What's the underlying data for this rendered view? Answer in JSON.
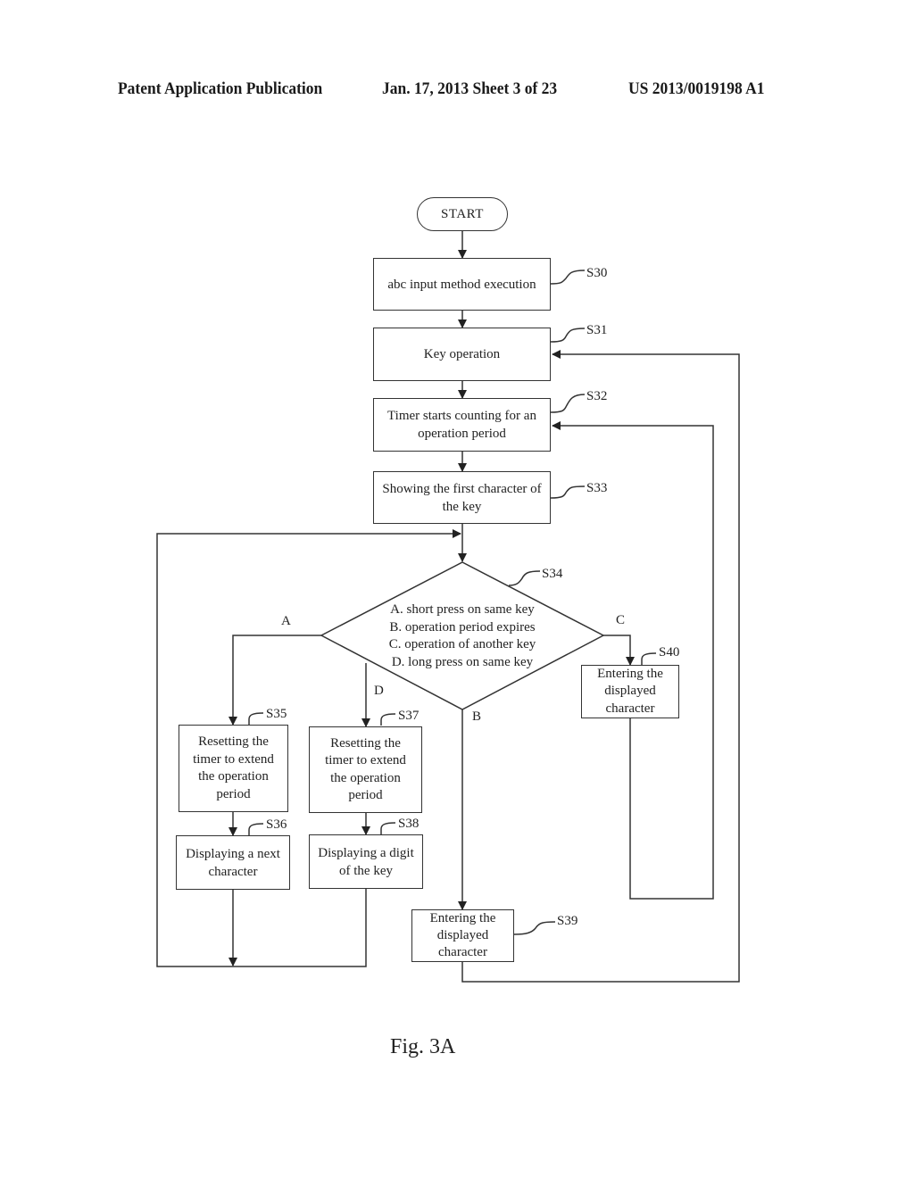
{
  "header": {
    "publication": "Patent Application Publication",
    "date_sheet": "Jan. 17, 2013  Sheet 3 of 23",
    "number": "US 2013/0019198 A1"
  },
  "flowchart": {
    "start": "START",
    "steps": {
      "s30": {
        "id": "S30",
        "text": "abc input method execution"
      },
      "s31": {
        "id": "S31",
        "text": "Key operation"
      },
      "s32": {
        "id": "S32",
        "text": "Timer starts counting for an\noperation period"
      },
      "s33": {
        "id": "S33",
        "text": "Showing the first character of\nthe key"
      },
      "s34": {
        "id": "S34",
        "conditions": [
          "A. short press on same key",
          "B. operation period expires",
          "C. operation of another key",
          "D. long press on same key"
        ]
      },
      "s35": {
        "id": "S35",
        "text": "Resetting the\ntimer to extend\nthe operation\nperiod"
      },
      "s36": {
        "id": "S36",
        "text": "Displaying a next\ncharacter"
      },
      "s37": {
        "id": "S37",
        "text": "Resetting the\ntimer to extend\nthe operation\nperiod"
      },
      "s38": {
        "id": "S38",
        "text": "Displaying a digit\nof the key"
      },
      "s39": {
        "id": "S39",
        "text": "Entering the\ndisplayed\ncharacter"
      },
      "s40": {
        "id": "S40",
        "text": "Entering the\ndisplayed\ncharacter"
      }
    },
    "branches": {
      "a": "A",
      "b": "B",
      "c": "C",
      "d": "D"
    }
  },
  "figure_label": "Fig. 3A"
}
